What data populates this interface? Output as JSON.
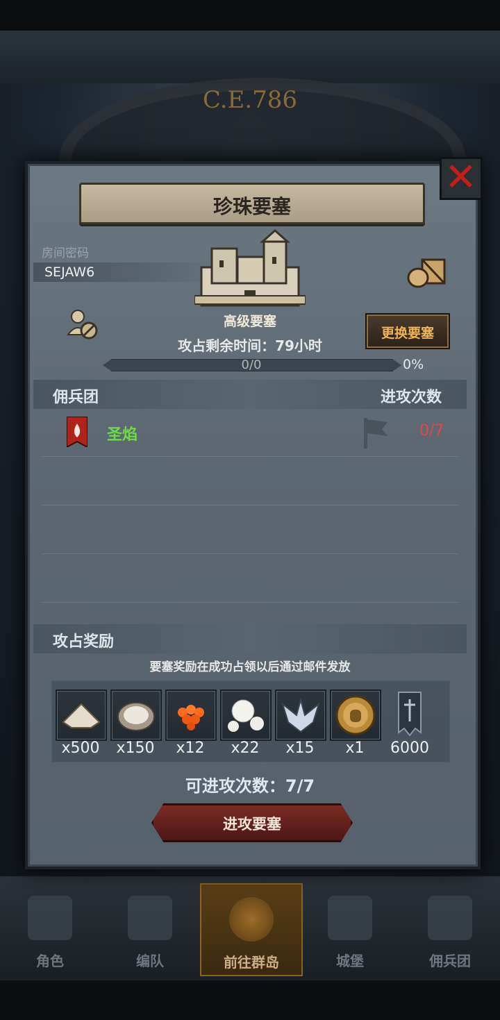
{
  "background": {
    "era_label": "C.E.786"
  },
  "modal": {
    "title": "珍珠要塞",
    "room_label": "房间密码",
    "room_code": "SEJAW6",
    "fortress_type": "高级要塞",
    "change_button": "更换要塞",
    "time_left": "攻占剩余时间：79小时",
    "progress": {
      "text": "0/0",
      "percent_text": "0%",
      "fraction": 0
    },
    "mercenary_header": "佣兵团",
    "attack_times_header": "进攻次数",
    "guilds": [
      {
        "name": "圣焰",
        "attacks": "0/7"
      }
    ],
    "reward_header": "攻占奖励",
    "reward_note": "要塞奖励在成功占领以后通过邮件发放",
    "rewards": [
      {
        "icon": "flour-pile-icon",
        "qty": "x500"
      },
      {
        "icon": "oyster-icon",
        "qty": "x150"
      },
      {
        "icon": "roe-icon",
        "qty": "x12"
      },
      {
        "icon": "pearl-icon",
        "qty": "x22"
      },
      {
        "icon": "winged-emblem-icon",
        "qty": "x15"
      },
      {
        "icon": "knight-medal-icon",
        "qty": "x1"
      },
      {
        "icon": "guild-banner-icon",
        "qty": "6000"
      }
    ],
    "remaining_attacks": "可进攻次数：7/7",
    "attack_button": "进攻要塞"
  },
  "bottom_nav": [
    {
      "label": "角色",
      "active": false
    },
    {
      "label": "编队",
      "active": false
    },
    {
      "label": "前往群岛",
      "active": true
    },
    {
      "label": "城堡",
      "active": false
    },
    {
      "label": "佣兵团",
      "active": false
    }
  ],
  "colors": {
    "accent_gold": "#f0b35a",
    "guild_green": "#6bdb4a",
    "count_red": "#e04848",
    "close_red": "#c41e16"
  }
}
